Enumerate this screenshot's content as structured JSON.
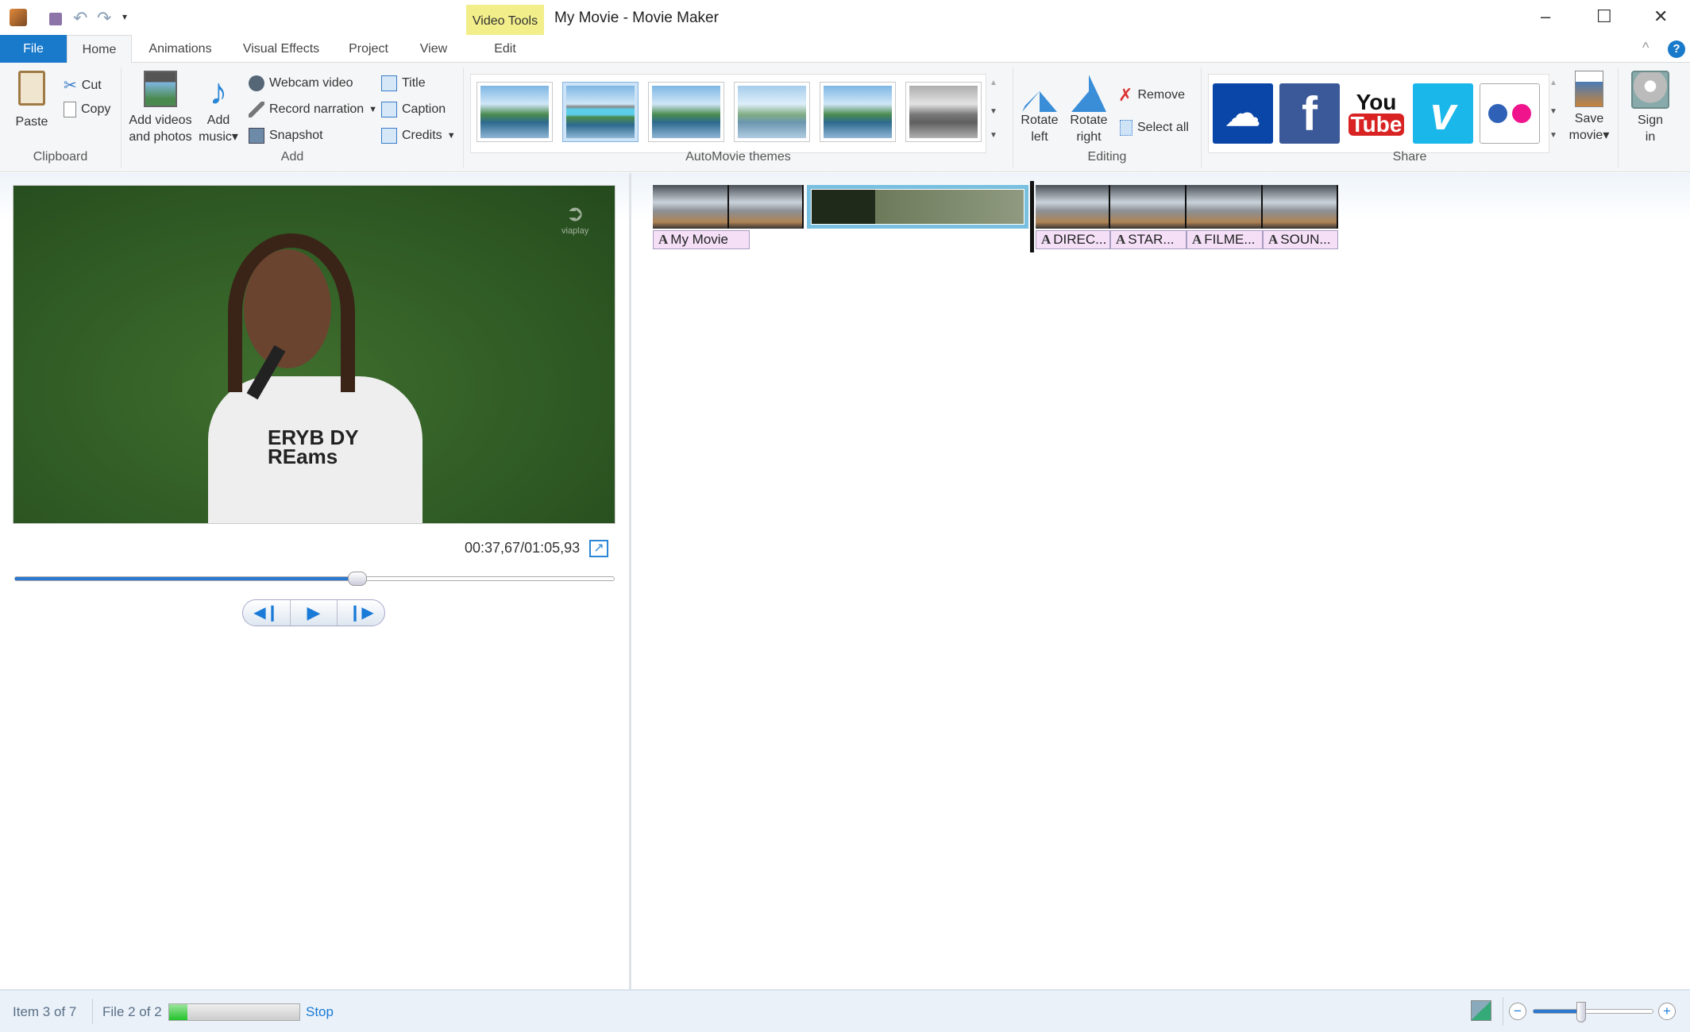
{
  "window": {
    "title": "My Movie - Movie Maker",
    "context_tab_group": "Video Tools",
    "minimize": "–",
    "maximize": "☐",
    "close": "✕"
  },
  "tabs": [
    {
      "label": "File"
    },
    {
      "label": "Home"
    },
    {
      "label": "Animations"
    },
    {
      "label": "Visual Effects"
    },
    {
      "label": "Project"
    },
    {
      "label": "View"
    },
    {
      "label": "Edit"
    }
  ],
  "ribbon": {
    "clipboard": {
      "label": "Clipboard",
      "paste": "Paste",
      "cut": "Cut",
      "copy": "Copy"
    },
    "add": {
      "label": "Add",
      "add_videos_1": "Add videos",
      "add_videos_2": "and photos",
      "add_music_1": "Add",
      "add_music_2": "music",
      "webcam": "Webcam video",
      "narration": "Record narration",
      "snapshot": "Snapshot",
      "title": "Title",
      "caption": "Caption",
      "credits": "Credits"
    },
    "themes": {
      "label": "AutoMovie themes",
      "count": 6,
      "selected": 1
    },
    "editing": {
      "label": "Editing",
      "rotate_left_1": "Rotate",
      "rotate_left_2": "left",
      "rotate_right_1": "Rotate",
      "rotate_right_2": "right",
      "remove": "Remove",
      "select_all": "Select all"
    },
    "share": {
      "label": "Share",
      "save_movie_1": "Save",
      "save_movie_2": "movie",
      "sign_in_1": "Sign",
      "sign_in_2": "in",
      "services": [
        "OneDrive",
        "Facebook",
        "YouTube",
        "Vimeo",
        "Flickr"
      ],
      "youtube_1": "You",
      "youtube_2": "Tube",
      "facebook": "f",
      "vimeo": "v"
    }
  },
  "preview": {
    "time": "00:37,67/01:05,93",
    "progress": 0.571,
    "watermark": "viaplay",
    "shirt_text_1": "ERYB DY",
    "shirt_text_2": "REams"
  },
  "storyboard": {
    "captions": [
      "My Movie",
      "DIREC...",
      "STAR...",
      "FILME...",
      "SOUN..."
    ]
  },
  "status": {
    "item": "Item 3 of 7",
    "file": "File 2 of 2",
    "progress": 0.14,
    "stop": "Stop",
    "zoom": 0.4
  },
  "colors": {
    "accent": "#1979ca",
    "context": "#f2ee8a",
    "progress_green": "#22c32b"
  }
}
